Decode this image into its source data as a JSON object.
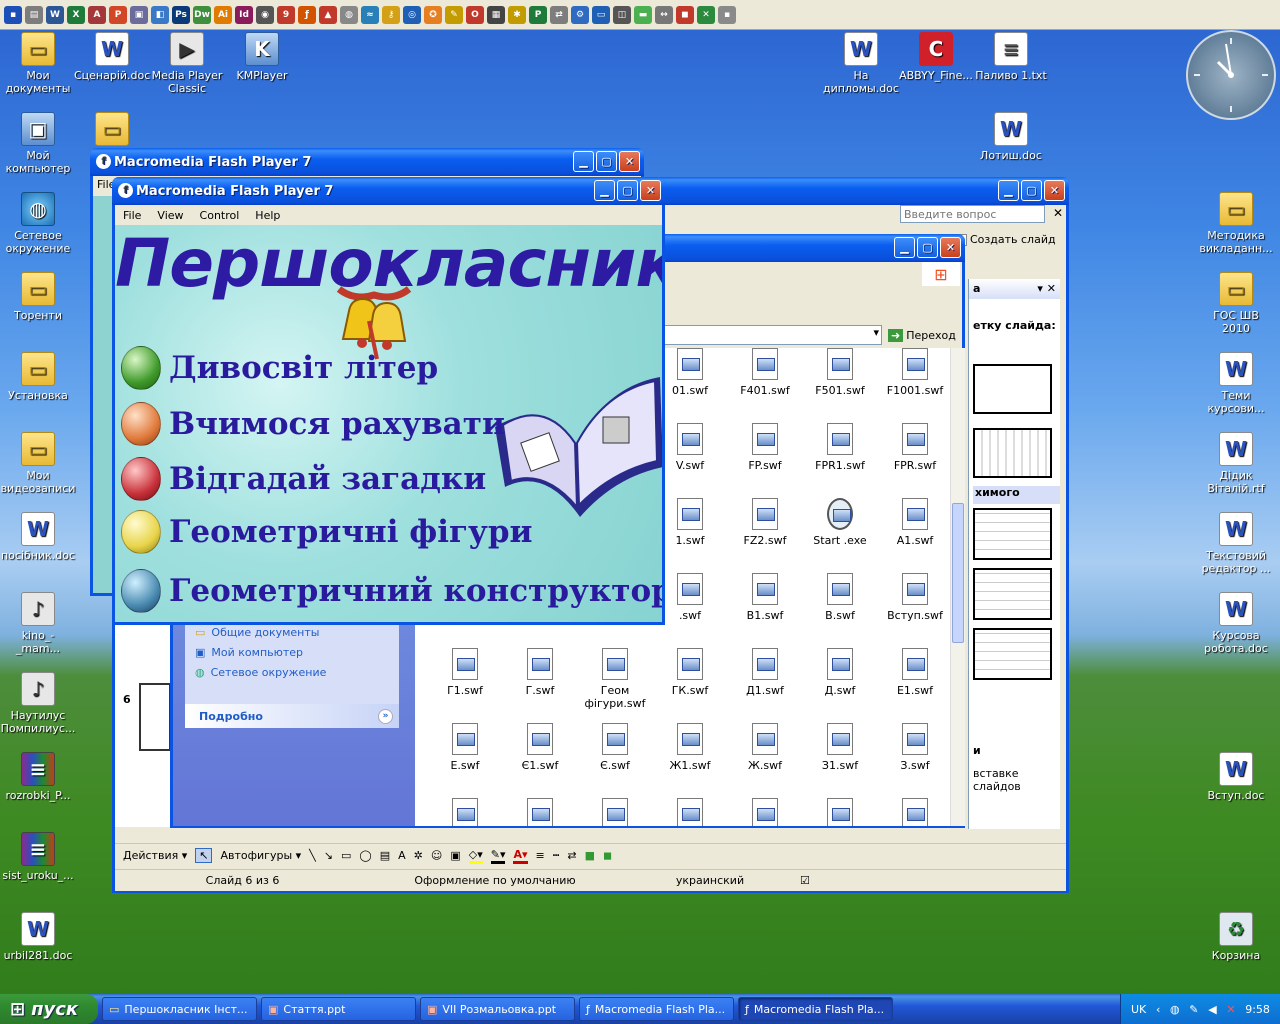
{
  "desktop": {
    "icons_left": [
      {
        "label": "Мои документы",
        "icon": "folder"
      },
      {
        "label": "Мой компьютер",
        "icon": "computer"
      },
      {
        "label": "Сетевое окружение",
        "icon": "network"
      },
      {
        "label": "Торенти",
        "icon": "folder"
      },
      {
        "label": "Установка",
        "icon": "folder"
      },
      {
        "label": "Мои видеозаписи",
        "icon": "folder"
      },
      {
        "label": "посібник.doc",
        "icon": "word-doc"
      },
      {
        "label": "kino_-_mam...",
        "icon": "file"
      },
      {
        "label": "Наутилус Помпилиус...",
        "icon": "file"
      },
      {
        "label": "rozrobki_P...",
        "icon": "rar"
      },
      {
        "label": "sist_uroku_...",
        "icon": "rar"
      },
      {
        "label": "urbil281.doc",
        "icon": "word-doc"
      }
    ],
    "icons_top": [
      {
        "label": "Сценарій.doc",
        "icon": "word-doc"
      },
      {
        "label": "Media Player Classic",
        "icon": "media"
      },
      {
        "label": "KMPlayer",
        "icon": "kmp"
      },
      {
        "label": "",
        "icon": "folder"
      }
    ],
    "icons_right": [
      {
        "label": "На дипломы.doc",
        "icon": "word-doc"
      },
      {
        "label": "ABBYY_Fine...",
        "icon": "abbyy"
      },
      {
        "label": "Паливо 1.txt",
        "icon": "txt"
      },
      {
        "label": "Лотиш.doc",
        "icon": "word-doc"
      },
      {
        "label": "Методика викладанн...",
        "icon": "folder"
      },
      {
        "label": "ГОС ШВ 2010",
        "icon": "folder"
      },
      {
        "label": "Теми курсови...",
        "icon": "word-doc"
      },
      {
        "label": "Дідик Віталій.rtf",
        "icon": "word-doc"
      },
      {
        "label": "Текстовий редактор ...",
        "icon": "word-doc"
      },
      {
        "label": "Курсова робота.doc",
        "icon": "word-doc"
      },
      {
        "label": "Вступ.doc",
        "icon": "word-doc"
      },
      {
        "label": "Корзина",
        "icon": "recycle-bin"
      }
    ]
  },
  "flash_back": {
    "title": "Macromedia Flash Player 7",
    "menu_first": "File"
  },
  "flash_front": {
    "title": "Macromedia Flash Player 7",
    "menu": [
      "File",
      "View",
      "Control",
      "Help"
    ],
    "heading": "Першокласник",
    "items": [
      {
        "label": "Дивосвіт літер",
        "egg": "green"
      },
      {
        "label": "Вчимося рахувати",
        "egg": "orange"
      },
      {
        "label": "Відгадай загадки",
        "egg": "red"
      },
      {
        "label": "Геометричні фігури",
        "egg": "yellow"
      },
      {
        "label": "Геометричний конструктор",
        "egg": "blue"
      }
    ]
  },
  "powerpoint": {
    "help_placeholder": "Введите вопрос",
    "create_slide": "Создать слайд",
    "panel_title": "а",
    "layout_label": "етку слайда:",
    "section2": "химого",
    "section3": "и",
    "insert_slides": "вставке слайдов",
    "slide_number": "6",
    "draw_actions": "Действия",
    "draw_autoshapes": "Автофигуры",
    "status_slide": "Слайд 6 из 6",
    "status_design": "Оформление по умолчанию",
    "status_lang": "украинский"
  },
  "explorer": {
    "go_label": "Переход",
    "side_links": [
      "Общие документы",
      "Мой компьютер",
      "Сетевое окружение"
    ],
    "details_label": "Подробно",
    "files": [
      [
        "01.swf",
        "F401.swf",
        "F501.swf",
        "F1001.swf"
      ],
      [
        "V.swf",
        "FP.swf",
        "FPR1.swf",
        "FPR.swf"
      ],
      [
        "1.swf",
        "FZ2.swf",
        "Start .exe",
        "A1.swf"
      ],
      [
        ".swf",
        "B1.swf",
        "B.swf",
        "Вступ.swf"
      ],
      [
        "Г1.swf",
        "Г.swf",
        "Геом фігури.swf",
        "ГК.swf",
        "Д1.swf",
        "Д.swf",
        "Е1.swf"
      ],
      [
        "Е.swf",
        "Є1.swf",
        "Є.swf",
        "Ж1.swf",
        "Ж.swf",
        "З1.swf",
        "З.swf"
      ]
    ]
  },
  "taskbar": {
    "start": "пуск",
    "tasks": [
      "Першокласник Інст...",
      "Стаття.ppt",
      "VII Розмальовка.ppt",
      "Macromedia Flash Pla...",
      "Macromedia Flash Pla..."
    ],
    "lang": "UK",
    "time": "9:58"
  },
  "toolbar_icons": [
    "save-icon",
    "word-icon",
    "excel-icon",
    "access-icon",
    "powerpoint-icon",
    "paint-icon",
    "photoshop-icon",
    "dreamweaver-icon",
    "illustrator-icon",
    "indesign-icon",
    "browser-icon",
    "acrobat-icon",
    "nero-icon",
    "settings-icon",
    "firefox-icon",
    "opera-icon"
  ]
}
